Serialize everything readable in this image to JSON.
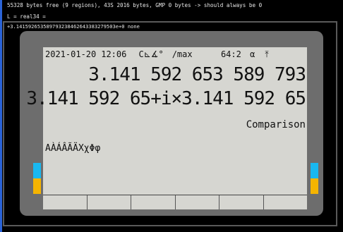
{
  "console": {
    "line1": "55328 bytes free (9 regions), 43S 2016 bytes, GMP 0 bytes -> should always be 0",
    "line2": "L = real34 =",
    "line3": "+3.141592653589793238462643383279503e+0 none"
  },
  "status": {
    "date": "2021-01-20",
    "time": "12:06",
    "mode": "C⊾∡°",
    "max": "/max",
    "format": "64:2",
    "alpha": "α",
    "arrow": "⤒"
  },
  "display": {
    "line1": "3.141 592 653 589 793",
    "line2": "3.141 592 65+i×3.141 592 65",
    "label": "Comparison",
    "chars": "AÀÁÂÃÄXχΦφ"
  },
  "colors": {
    "indicator_top": "#19b8f0",
    "indicator_bottom": "#f5b400",
    "lcd_background": "#d6d6d1",
    "frame": "#5a5a5a",
    "left_edge": "#2b64d8"
  },
  "softkeys": [
    "",
    "",
    "",
    "",
    "",
    ""
  ]
}
